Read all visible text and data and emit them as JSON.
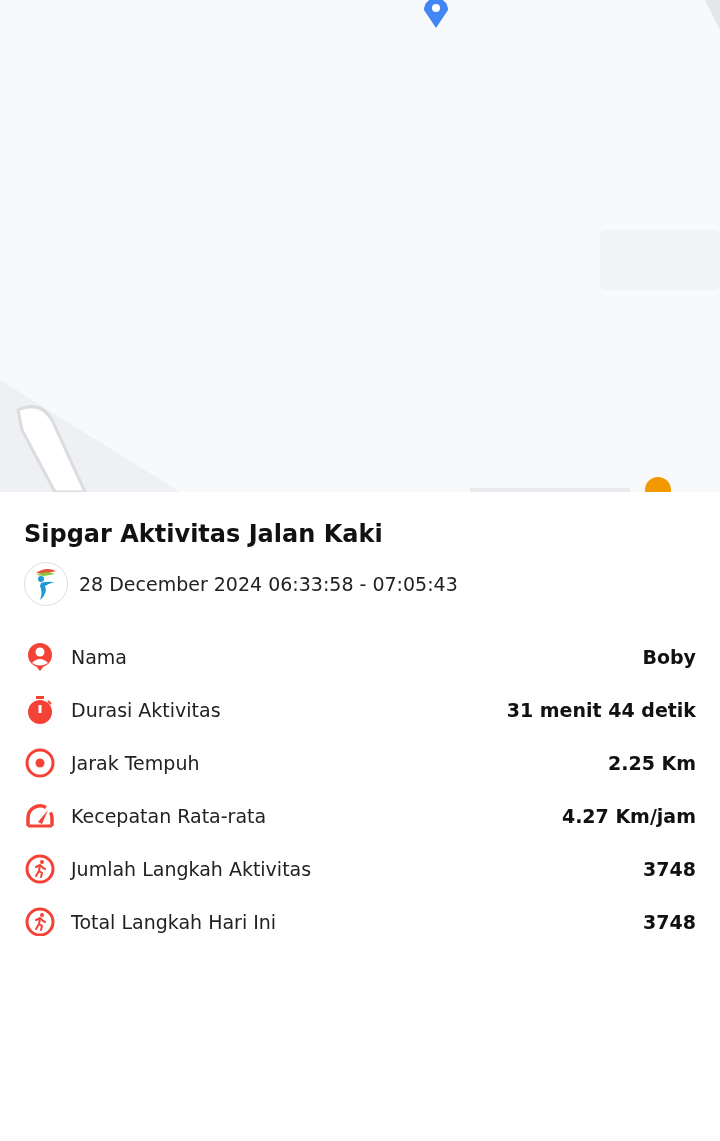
{
  "title": "Sipgar Aktivitas Jalan Kaki",
  "date_range": "28 December 2024 06:33:58 - 07:05:43",
  "stats": [
    {
      "kind": "person",
      "label": "Nama",
      "value": "Boby"
    },
    {
      "kind": "timer",
      "label": "Durasi Aktivitas",
      "value": "31 menit 44 detik"
    },
    {
      "kind": "target",
      "label": "Jarak Tempuh",
      "value": "2.25 Km"
    },
    {
      "kind": "gauge",
      "label": "Kecepatan Rata-rata",
      "value": "4.27 Km/jam"
    },
    {
      "kind": "runner",
      "label": "Jumlah Langkah Aktivitas",
      "value": "3748"
    },
    {
      "kind": "runner",
      "label": "Total Langkah Hari Ini",
      "value": "3748"
    }
  ]
}
